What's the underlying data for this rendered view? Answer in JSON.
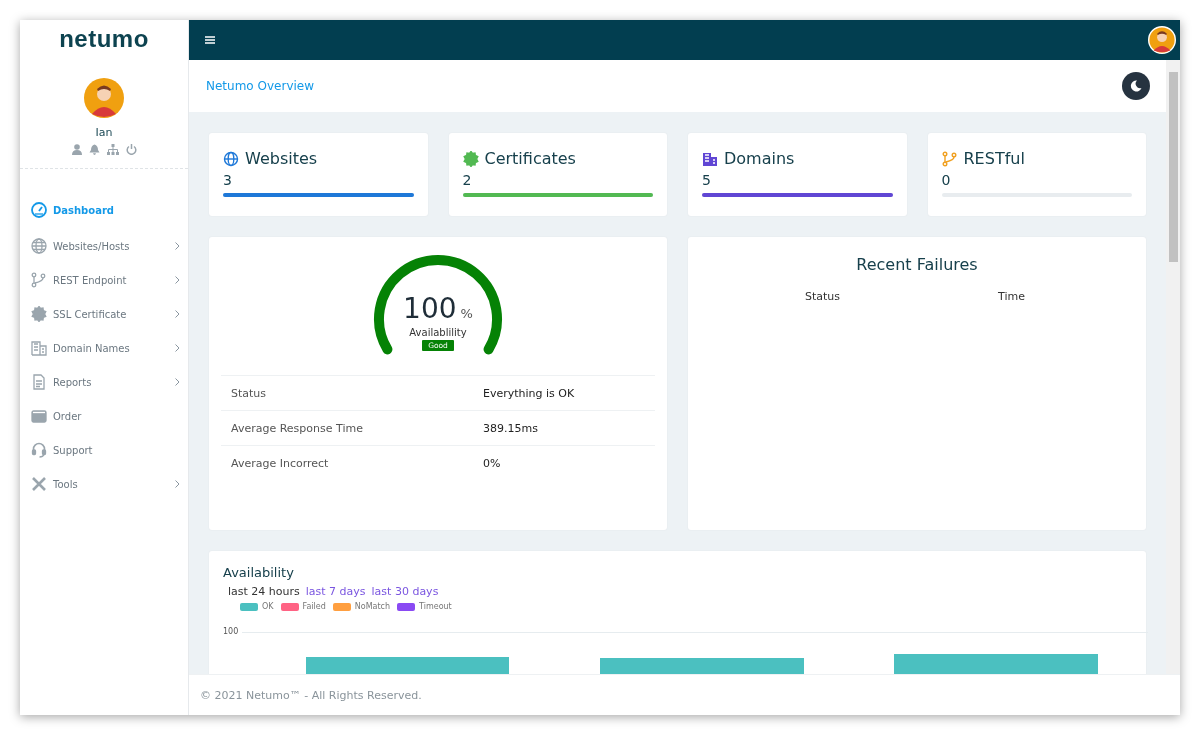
{
  "sidebar": {
    "logo": "netumo",
    "user": "Ian",
    "items": [
      {
        "label": "Dashboard",
        "selected": true,
        "has_submenu": false
      },
      {
        "label": "Websites/Hosts",
        "selected": false,
        "has_submenu": true
      },
      {
        "label": "REST Endpoint",
        "selected": false,
        "has_submenu": true
      },
      {
        "label": "SSL Certificate",
        "selected": false,
        "has_submenu": true
      },
      {
        "label": "Domain Names",
        "selected": false,
        "has_submenu": true
      },
      {
        "label": "Reports",
        "selected": false,
        "has_submenu": true
      },
      {
        "label": "Order",
        "selected": false,
        "has_submenu": false
      },
      {
        "label": "Support",
        "selected": false,
        "has_submenu": false
      },
      {
        "label": "Tools",
        "selected": false,
        "has_submenu": true
      }
    ]
  },
  "header": {
    "breadcrumb": "Netumo Overview"
  },
  "stats": [
    {
      "title": "Websites",
      "count": "3",
      "level": 1,
      "color": "#1e78d8"
    },
    {
      "title": "Certificates",
      "count": "2",
      "level": 1,
      "color": "#52b952"
    },
    {
      "title": "Domains",
      "count": "5",
      "level": 1,
      "color": "#6046d4"
    },
    {
      "title": "RESTful",
      "count": "0",
      "level": 0,
      "color": "#f0a020"
    }
  ],
  "gauge": {
    "value": "100",
    "unit": "%",
    "label": "Availablility",
    "badge": "Good"
  },
  "summary": [
    {
      "label": "Status",
      "value": "Everything is OK"
    },
    {
      "label": "Average Response Time",
      "value": "389.15ms"
    },
    {
      "label": "Average Incorrect",
      "value": "0%"
    }
  ],
  "failures": {
    "title": "Recent Failures",
    "columns": [
      "Status",
      "Time"
    ]
  },
  "availability": {
    "title": "Availability",
    "ranges": [
      {
        "label": "last 24 hours",
        "selected": true
      },
      {
        "label": "last 7 days",
        "selected": false
      },
      {
        "label": "last 30 days",
        "selected": false
      }
    ],
    "legend": [
      {
        "label": "OK",
        "color": "#4bc0c0"
      },
      {
        "label": "Failed",
        "color": "#ff6384"
      },
      {
        "label": "NoMatch",
        "color": "#ff9f40"
      },
      {
        "label": "Timeout",
        "color": "#8a4af3"
      }
    ],
    "tick_label": "100"
  },
  "footer": "© 2021 Netumo™ - All Rights Reserved."
}
